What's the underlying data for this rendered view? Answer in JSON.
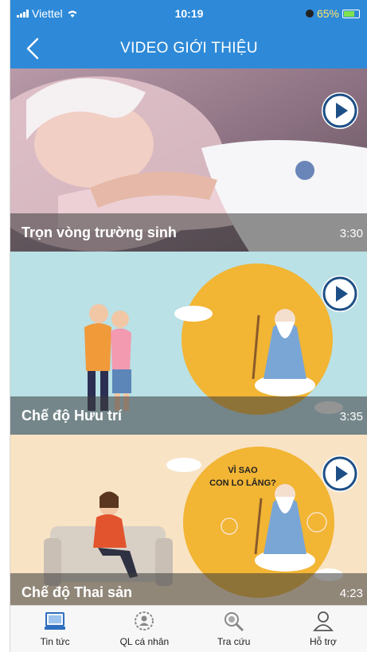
{
  "status_bar": {
    "carrier": "Viettel",
    "time": "10:19",
    "battery": "65%"
  },
  "header": {
    "title": "VIDEO GIỚI THIỆU"
  },
  "videos": [
    {
      "title": "Trọn vòng trường sinh",
      "duration": "3:30"
    },
    {
      "title": "Chế độ Hưu trí",
      "duration": "3:35"
    },
    {
      "title": "Chế độ Thai sản",
      "duration": "4:23",
      "overlay_text": [
        "VÌ SAO",
        "CON LO LẮNG?"
      ]
    }
  ],
  "tabs": [
    {
      "label": "Tin tức",
      "icon": "news-icon"
    },
    {
      "label": "QL cá nhân",
      "icon": "personal-settings-icon"
    },
    {
      "label": "Tra cứu",
      "icon": "search-lookup-icon"
    },
    {
      "label": "Hỗ trợ",
      "icon": "support-user-icon"
    }
  ],
  "colors": {
    "brand": "#2e8ad8",
    "play": "#1d4f86",
    "sun": "#f2b534"
  }
}
